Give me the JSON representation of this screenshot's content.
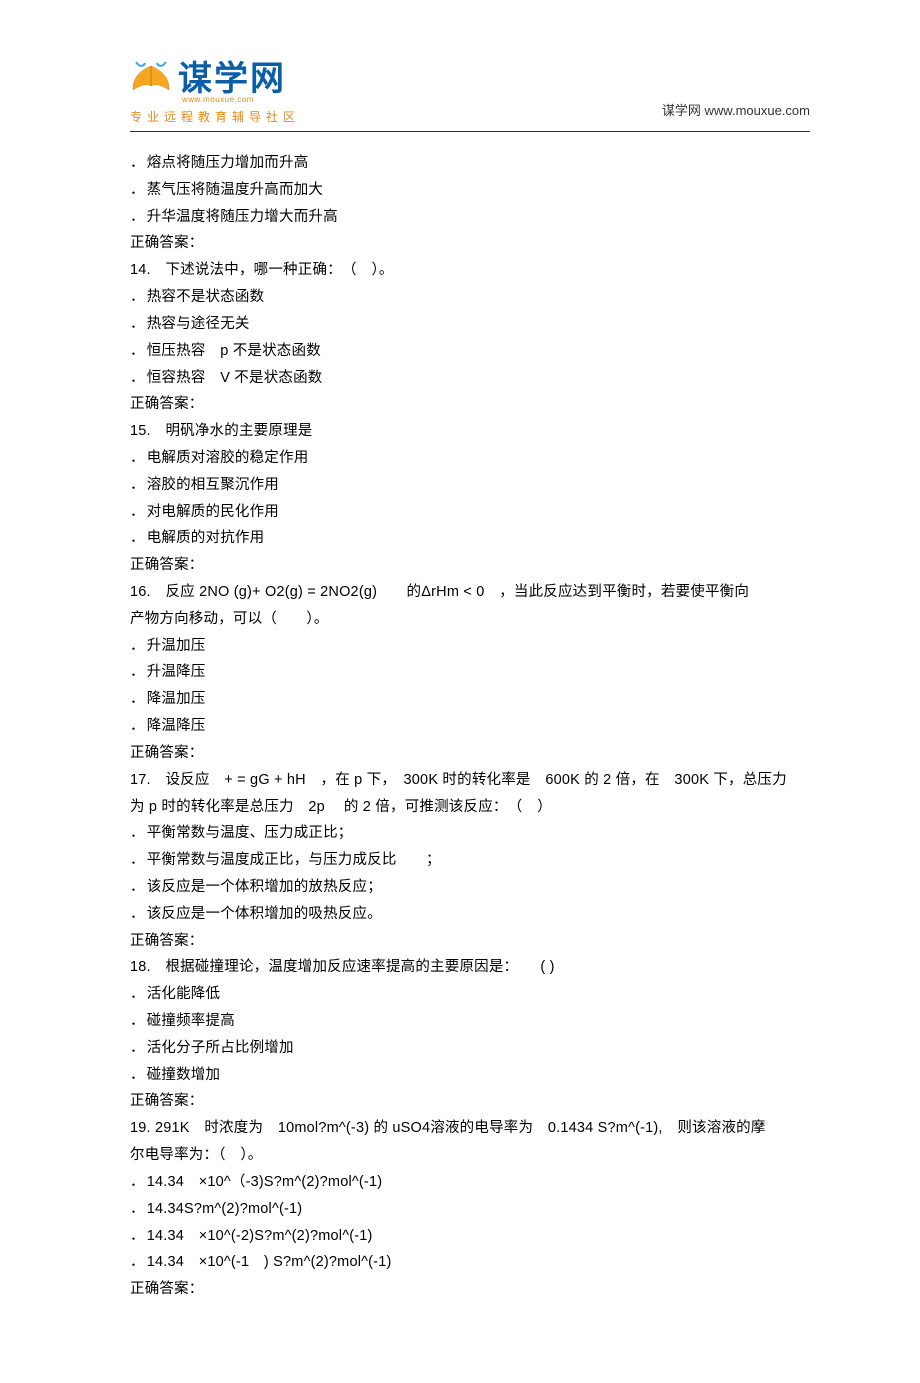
{
  "header": {
    "logo_main": "谋学网",
    "logo_url_small": "www.mouxue.com",
    "logo_slogan": "专业远程教育辅导社区",
    "right_label": "谋学网",
    "right_link": "www.mouxue.com"
  },
  "pre_options": {
    "a": "熔点将随压力增加而升高",
    "b": "蒸气压将随温度升高而加大",
    "c": "升华温度将随压力增大而升高",
    "ans_label": "正确答案："
  },
  "q14": {
    "stem": "14.　下述说法中，哪一种正确：　（　）。",
    "a": "热容不是状态函数",
    "b": "热容与途径无关",
    "c": "恒压热容　p 不是状态函数",
    "d": "恒容热容　V 不是状态函数",
    "ans_label": "正确答案："
  },
  "q15": {
    "stem": "15.　明矾净水的主要原理是",
    "a": "电解质对溶胶的稳定作用",
    "b": "溶胶的相互聚沉作用",
    "c": "对电解质的民化作用",
    "d": "电解质的对抗作用",
    "ans_label": "正确答案："
  },
  "q16": {
    "stem1": "16.　反应 2NO (g)+ O2(g) = 2NO2(g)　　的ΔrHm < 0　，当此反应达到平衡时，若要使平衡向",
    "stem2": "产物方向移动，可以（　　）。",
    "a": "升温加压",
    "b": "升温降压",
    "c": "降温加压",
    "d": "降温降压",
    "ans_label": "正确答案："
  },
  "q17": {
    "stem1": "17.　设反应　+  = gG + hH　，在 p 下，　300K 时的转化率是　600K 的 2 倍，在　300K 下，总压力",
    "stem2": "为 p 时的转化率是总压力　2p　 的 2 倍，可推测该反应：　（　）",
    "a": "平衡常数与温度、压力成正比；",
    "b": "平衡常数与温度成正比，与压力成反比　　；",
    "c": "该反应是一个体积增加的放热反应；",
    "d": "该反应是一个体积增加的吸热反应。",
    "ans_label": "正确答案："
  },
  "q18": {
    "stem": "18.　根据碰撞理论，温度增加反应速率提高的主要原因是：　　( )",
    "a": "活化能降低",
    "b": "碰撞频率提高",
    "c": "活化分子所占比例增加",
    "d": "碰撞数增加",
    "ans_label": "正确答案："
  },
  "q19": {
    "stem1": "19. 291K　时浓度为　10mol?m^(-3)  的 uSO4溶液的电导率为　0.1434 S?m^(-1),　则该溶液的摩",
    "stem2": "尔电导率为：（　）。",
    "a": "14.34　×10^（-3)S?m^(2)?mol^(-1)",
    "b": "14.34S?m^(2)?mol^(-1)",
    "c": "14.34　×10^(-2)S?m^(2)?mol^(-1)",
    "d": "14.34　×10^(-1　) S?m^(2)?mol^(-1)",
    "ans_label": "正确答案："
  }
}
